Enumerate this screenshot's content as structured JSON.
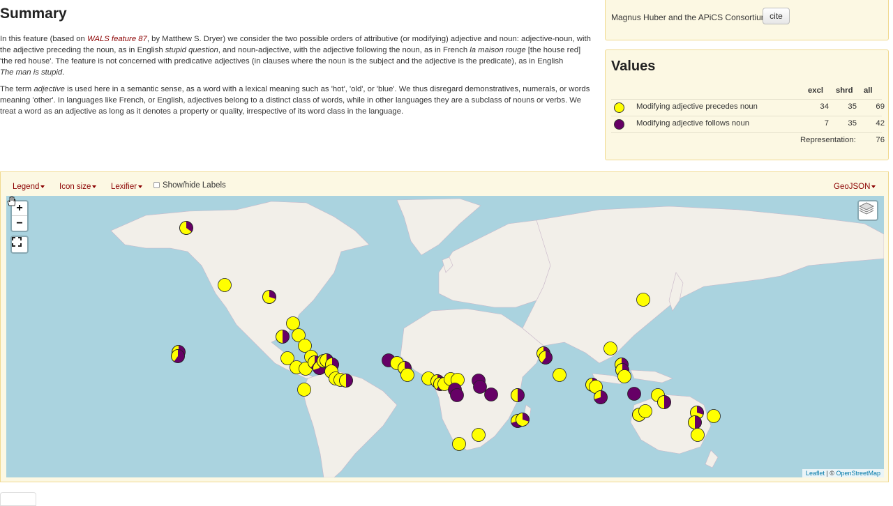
{
  "summary": {
    "title": "Summary",
    "p1_a": "In this feature (based on ",
    "p1_link": "WALS feature 87",
    "p1_b": ", by Matthew S. Dryer) we consider the two possible orders of attributive (or modifying) adjective and noun: adjective-noun, with the adjective preceding the noun, as in English ",
    "p1_i1": "stupid question",
    "p1_c": ", and noun-adjective, with the adjective following the noun, as in French ",
    "p1_i2": "la maison rouge",
    "p1_d": " [the house red] 'the red house'. The feature is not concerned with predicative adjectives (in clauses where the noun is the subject and the adjective is the predicate), as in English ",
    "p1_i3": "The man is stupid",
    "p1_e": ".",
    "p2_a": "The term ",
    "p2_i": "adjective",
    "p2_b": " is used here in a semantic sense, as a word with a lexical meaning such as 'hot', 'old', or 'blue'. We thus disregard demonstratives, numerals, or words meaning 'other'. In languages like French, or English, adjectives belong to a distinct class of words, while in other languages they are a subclass of nouns or verbs. We treat a word as an adjective as long as it denotes a property or quality, irrespective of its word class in the language."
  },
  "cite_panel": {
    "authors": "Magnus Huber and the APiCS Consortium",
    "cite_label": "cite"
  },
  "values": {
    "title": "Values",
    "headers": {
      "excl": "excl",
      "shrd": "shrd",
      "all": "all"
    },
    "rows": [
      {
        "label": "Modifying adjective precedes noun",
        "color": "#ffff00",
        "excl": "34",
        "shrd": "35",
        "all": "69"
      },
      {
        "label": "Modifying adjective follows noun",
        "color": "#660066",
        "excl": "7",
        "shrd": "35",
        "all": "42"
      }
    ],
    "representation_label": "Representation:",
    "representation_value": "76"
  },
  "map_controls": {
    "legend": "Legend",
    "icon_size": "Icon size",
    "lexifier": "Lexifier",
    "show_labels": "Show/hide Labels",
    "geojson": "GeoJSON",
    "zoom_in": "+",
    "zoom_out": "−"
  },
  "attribution": {
    "leaflet": "Leaflet",
    "sep": " | © ",
    "osm": "OpenStreetMap"
  },
  "colors": {
    "precedes": "#ffff00",
    "follows": "#660066",
    "ocean": "#aad3df",
    "land": "#f2efe9"
  }
}
